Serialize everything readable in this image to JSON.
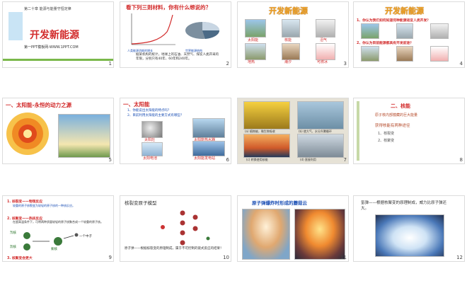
{
  "slides": [
    {
      "num": "1",
      "subtitle": "第二十章 能源与能量守恒定律",
      "title": "开发新能源",
      "footer": "第一PPT模板网-WWW.1PPT.COM"
    },
    {
      "num": "2",
      "heading": "看下列三则材料，你有什么想说的？",
      "legend1": "人类能源消耗的增长",
      "legend2": "世界能源结构",
      "body": "据某机构的统计，地球上的石油、天然气、煤炭人类开采的年限，分别只有40年、60年和240年。"
    },
    {
      "num": "3",
      "title": "开发新能源",
      "captions": [
        "太阳能",
        "核能",
        "沼气",
        "地热",
        "潮汐",
        "可燃冰"
      ]
    },
    {
      "num": "4",
      "title": "开发新能源",
      "q1": "1、你认为我们如何知道何种能源适宜人类开发？",
      "q2": "2、你认为目前能源都具有开发前途？"
    },
    {
      "num": "5",
      "heading": "一、太阳能-永恒的动力之源"
    },
    {
      "num": "6",
      "heading": "一、太阳能",
      "q1": "1、你能说出太阳能的特点吗？",
      "q2": "2、目前利用太阳能的主要方式有哪些？",
      "captions": [
        "太阳灶",
        "太阳能热水器",
        "太阳电池",
        "太阳能发电站"
      ]
    },
    {
      "num": "7",
      "captions": [
        "(a) 植物被，微生物吸收",
        "(b) 使大气、水分升腾循环",
        "(c) 转换使用核能",
        "(d) 直接利用"
      ]
    },
    {
      "num": "8",
      "heading": "二、核能",
      "lines": [
        "原子核内部蕴藏的巨大能量",
        "获得核能有两种途径",
        "1、核裂变",
        "2、核聚变"
      ]
    },
    {
      "num": "9",
      "p1": "1. 核裂变——物理反应",
      "p1b": "较重的原子核裂变为较轻的原子核的一种核反应。",
      "p2": "2. 核聚变——热核反应",
      "p2b": "在超高温条件下，可将两种质量较轻的原子核聚合成一个较重的原子核。",
      "labels": [
        "氘核",
        "氚核",
        "氦核",
        "一个中子"
      ],
      "p3": "3. 核聚变会更大"
    },
    {
      "num": "10",
      "title": "核裂变原子模型",
      "text": "原子弹——根据核裂变的原理制成，属于不可控制的链式反应的结果！"
    },
    {
      "num": "11",
      "title": "原子弹爆炸时形成的蘑菇云"
    },
    {
      "num": "12",
      "text": "氢弹——根据核聚变的原理制成，威力比原子弹还大。"
    }
  ],
  "colors": {
    "accent": "#d22a2a",
    "blue": "#1b4fb5",
    "green": "#7ab84a"
  }
}
